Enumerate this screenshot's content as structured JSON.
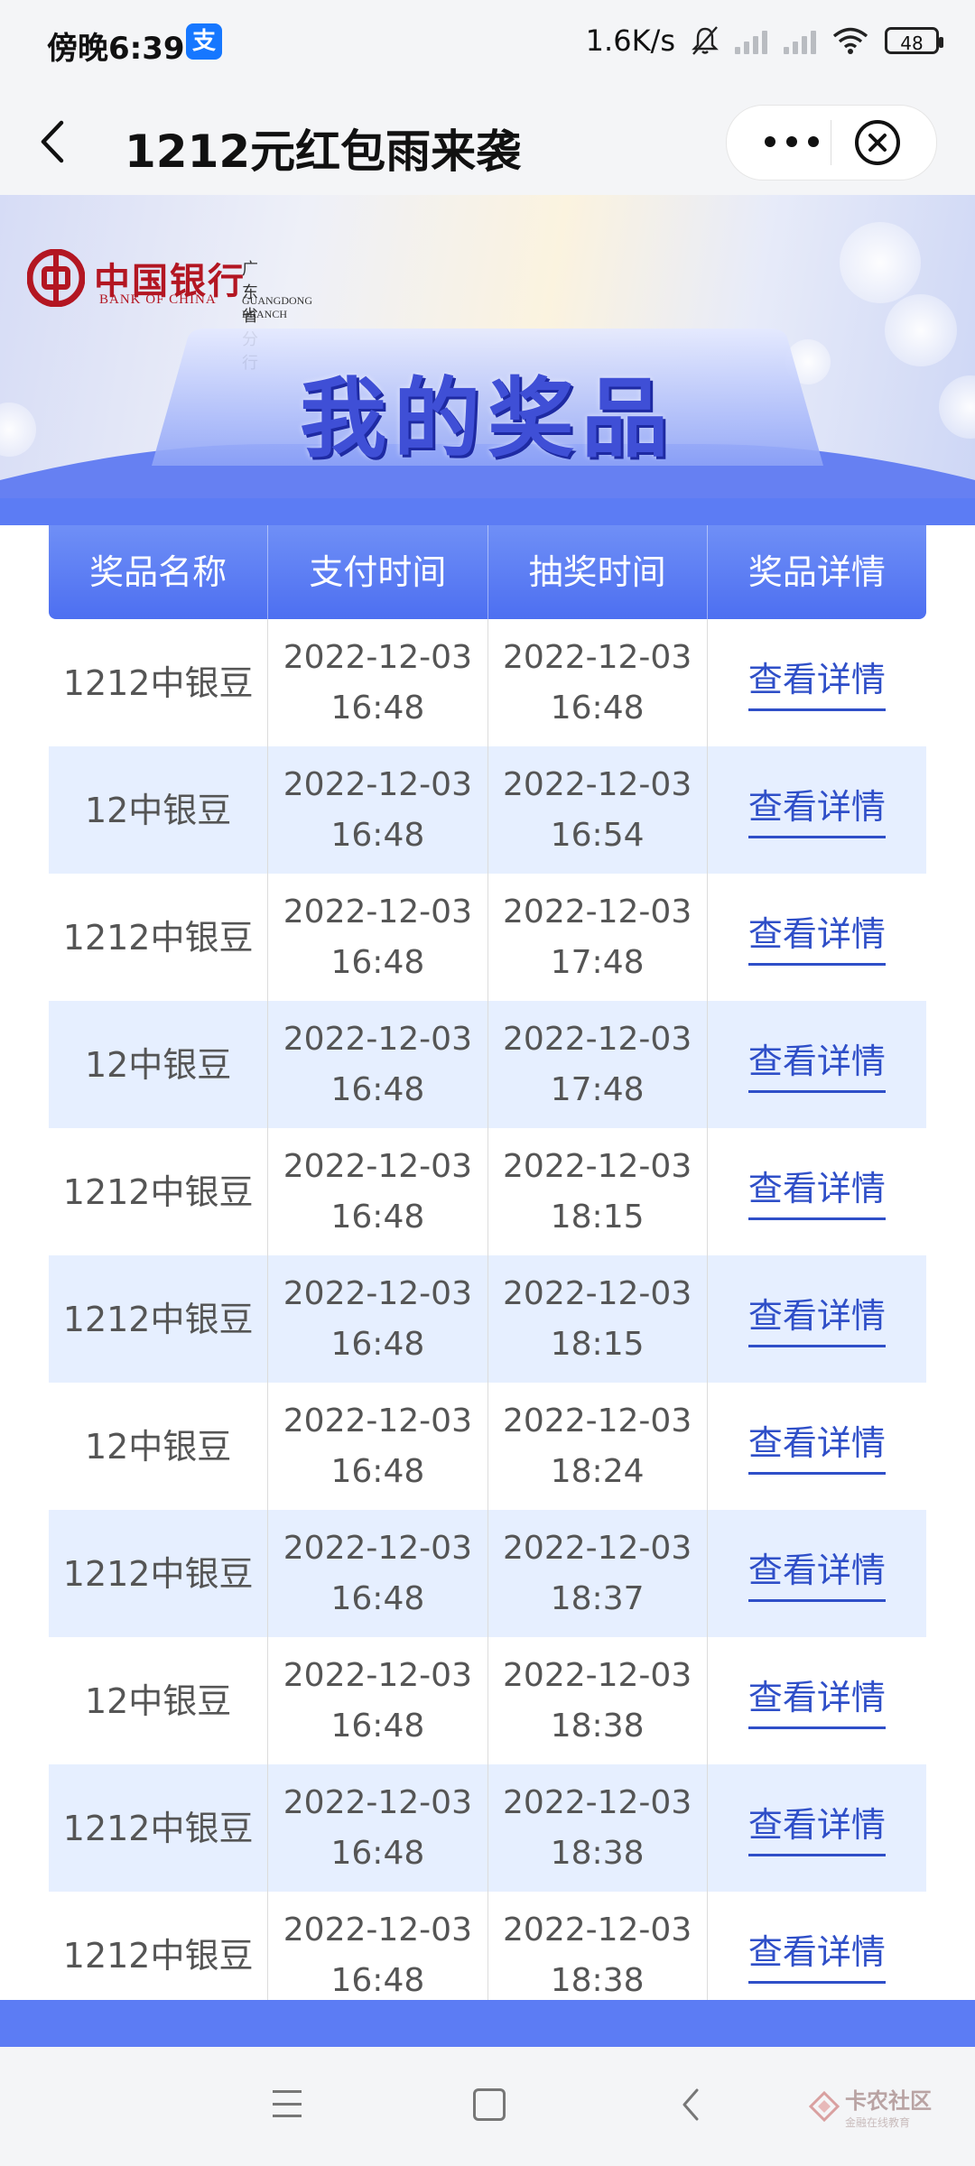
{
  "status": {
    "time": "傍晚6:39",
    "alipay_badge": "支",
    "net_speed": "1.6K/s",
    "battery": "48"
  },
  "nav": {
    "title": "1212元红包雨来袭"
  },
  "banner": {
    "bank_name_cn": "中国银行",
    "bank_name_en": "BANK OF CHINA",
    "branch_cn": "广东省分行",
    "branch_en": "GUANGDONG BRANCH",
    "heading": "我的奖品"
  },
  "table": {
    "headers": [
      "奖品名称",
      "支付时间",
      "抽奖时间",
      "奖品详情"
    ],
    "link_label": "查看详情",
    "rows": [
      {
        "prize": "1212中银豆",
        "pay_date": "2022-12-03",
        "pay_time": "16:48",
        "draw_date": "2022-12-03",
        "draw_time": "16:48"
      },
      {
        "prize": "12中银豆",
        "pay_date": "2022-12-03",
        "pay_time": "16:48",
        "draw_date": "2022-12-03",
        "draw_time": "16:54"
      },
      {
        "prize": "1212中银豆",
        "pay_date": "2022-12-03",
        "pay_time": "16:48",
        "draw_date": "2022-12-03",
        "draw_time": "17:48"
      },
      {
        "prize": "12中银豆",
        "pay_date": "2022-12-03",
        "pay_time": "16:48",
        "draw_date": "2022-12-03",
        "draw_time": "17:48"
      },
      {
        "prize": "1212中银豆",
        "pay_date": "2022-12-03",
        "pay_time": "16:48",
        "draw_date": "2022-12-03",
        "draw_time": "18:15"
      },
      {
        "prize": "1212中银豆",
        "pay_date": "2022-12-03",
        "pay_time": "16:48",
        "draw_date": "2022-12-03",
        "draw_time": "18:15"
      },
      {
        "prize": "12中银豆",
        "pay_date": "2022-12-03",
        "pay_time": "16:48",
        "draw_date": "2022-12-03",
        "draw_time": "18:24"
      },
      {
        "prize": "1212中银豆",
        "pay_date": "2022-12-03",
        "pay_time": "16:48",
        "draw_date": "2022-12-03",
        "draw_time": "18:37"
      },
      {
        "prize": "12中银豆",
        "pay_date": "2022-12-03",
        "pay_time": "16:48",
        "draw_date": "2022-12-03",
        "draw_time": "18:38"
      },
      {
        "prize": "1212中银豆",
        "pay_date": "2022-12-03",
        "pay_time": "16:48",
        "draw_date": "2022-12-03",
        "draw_time": "18:38"
      },
      {
        "prize": "1212中银豆",
        "pay_date": "2022-12-03",
        "pay_time": "16:48",
        "draw_date": "2022-12-03",
        "draw_time": "18:38"
      }
    ]
  },
  "watermark": {
    "text": "卡农社区",
    "sub": "金融在线教育"
  },
  "colors": {
    "accent": "#4d6ff1",
    "link": "#2f4fc8",
    "alt_row": "#e6efff",
    "boc_red": "#b31622"
  }
}
